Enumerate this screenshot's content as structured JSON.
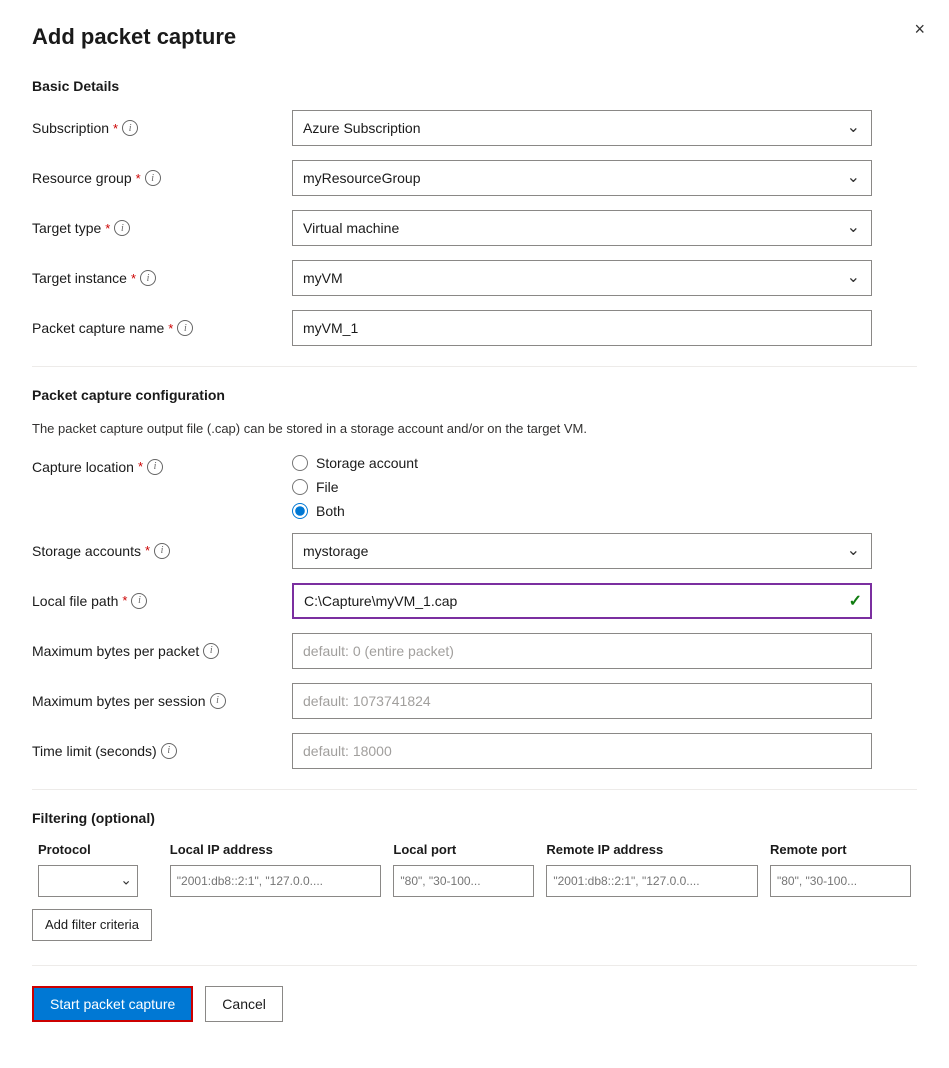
{
  "dialog": {
    "title": "Add packet capture",
    "close_label": "×"
  },
  "sections": {
    "basic_details": {
      "title": "Basic Details"
    },
    "packet_capture_config": {
      "title": "Packet capture configuration",
      "description": "The packet capture output file (.cap) can be stored in a storage account and/or on the target VM."
    },
    "filtering": {
      "title": "Filtering (optional)"
    }
  },
  "fields": {
    "subscription": {
      "label": "Subscription",
      "value": "Azure Subscription",
      "required": true
    },
    "resource_group": {
      "label": "Resource group",
      "value": "myResourceGroup",
      "required": true
    },
    "target_type": {
      "label": "Target type",
      "value": "Virtual machine",
      "required": true
    },
    "target_instance": {
      "label": "Target instance",
      "value": "myVM",
      "required": true
    },
    "packet_capture_name": {
      "label": "Packet capture name",
      "value": "myVM_1",
      "required": true
    },
    "capture_location": {
      "label": "Capture location",
      "required": true,
      "options": [
        "Storage account",
        "File",
        "Both"
      ],
      "selected": "Both"
    },
    "storage_accounts": {
      "label": "Storage accounts",
      "value": "mystorage",
      "required": true
    },
    "local_file_path": {
      "label": "Local file path",
      "value": "C:\\Capture\\myVM_1.cap",
      "required": true
    },
    "max_bytes_per_packet": {
      "label": "Maximum bytes per packet",
      "placeholder": "default: 0 (entire packet)"
    },
    "max_bytes_per_session": {
      "label": "Maximum bytes per session",
      "placeholder": "default: 1073741824"
    },
    "time_limit": {
      "label": "Time limit (seconds)",
      "placeholder": "default: 18000"
    }
  },
  "filter_table": {
    "columns": [
      "Protocol",
      "Local IP address",
      "Local port",
      "Remote IP address",
      "Remote port"
    ],
    "row": {
      "protocol": "",
      "local_ip": "\"2001:db8::2:1\", \"127.0.0....",
      "local_port": "\"80\", \"30-100...",
      "remote_ip": "\"2001:db8::2:1\", \"127.0.0....",
      "remote_port": "\"80\", \"30-100..."
    }
  },
  "buttons": {
    "add_filter": "Add filter criteria",
    "start_capture": "Start packet capture",
    "cancel": "Cancel"
  },
  "info_icon_label": "i"
}
